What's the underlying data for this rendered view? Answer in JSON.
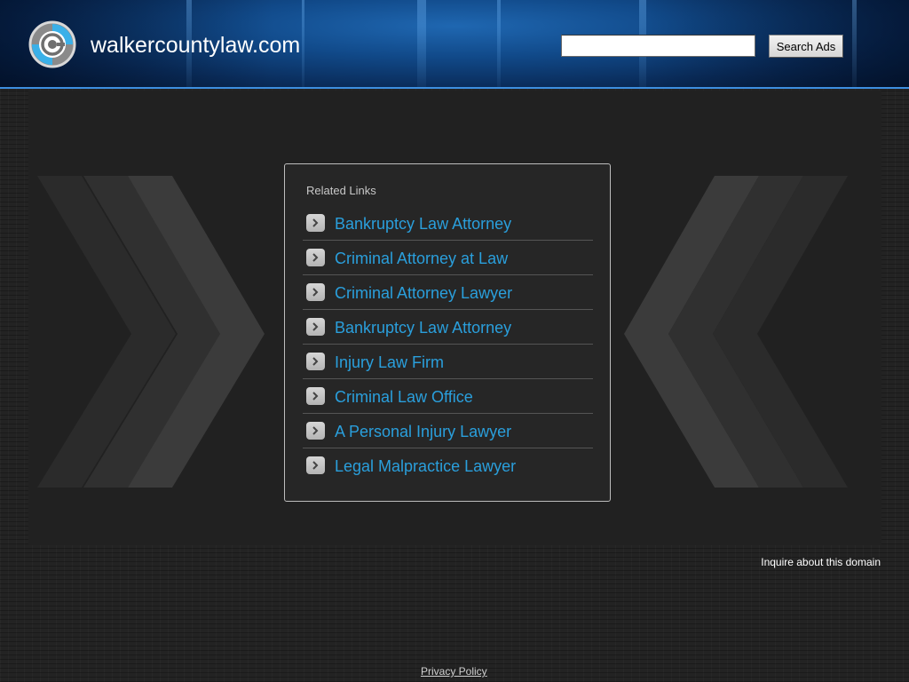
{
  "header": {
    "site_title": "walkercountylaw.com",
    "search_placeholder": "",
    "search_value": "",
    "search_button_label": "Search Ads",
    "logo_icon": "circular-at-logo-icon"
  },
  "related_links": {
    "heading": "Related Links",
    "items": [
      {
        "label": "Bankruptcy Law Attorney",
        "icon": "chevron-right-icon"
      },
      {
        "label": "Criminal Attorney at Law",
        "icon": "chevron-right-icon"
      },
      {
        "label": "Criminal Attorney Lawyer",
        "icon": "chevron-right-icon"
      },
      {
        "label": "Bankruptcy Law Attorney",
        "icon": "chevron-right-icon"
      },
      {
        "label": "Injury Law Firm",
        "icon": "chevron-right-icon"
      },
      {
        "label": "Criminal Law Office",
        "icon": "chevron-right-icon"
      },
      {
        "label": "A Personal Injury Lawyer",
        "icon": "chevron-right-icon"
      },
      {
        "label": "Legal Malpractice Lawyer",
        "icon": "chevron-right-icon"
      }
    ]
  },
  "footer": {
    "inquire_label": "Inquire about this domain",
    "privacy_label": "Privacy Policy"
  },
  "colors": {
    "link_color": "#2a9fdc",
    "header_accent": "#3d8fe0",
    "background": "#232323"
  }
}
